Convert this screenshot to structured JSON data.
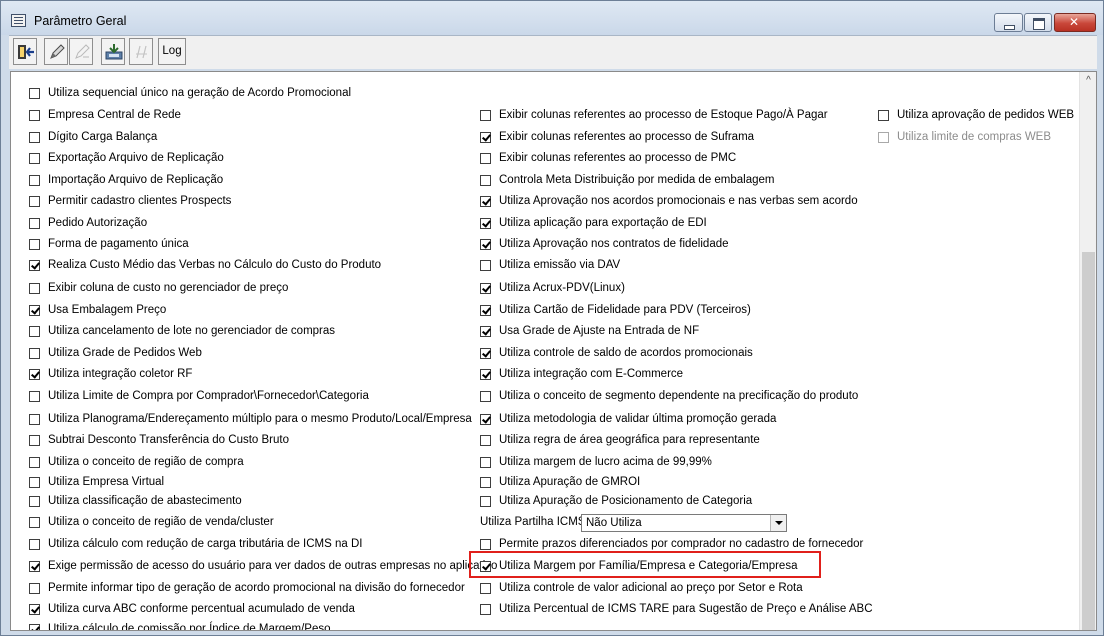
{
  "window": {
    "title": "Parâmetro Geral"
  },
  "toolbar": {
    "buttons": [
      {
        "name": "exit-icon"
      },
      {
        "name": "edit-icon"
      },
      {
        "name": "edit-disabled-icon"
      },
      {
        "name": "save-icon"
      },
      {
        "name": "cancel-disabled-icon"
      }
    ],
    "log_label": "Log"
  },
  "col1": [
    {
      "label": "Utiliza sequencial único na geração de Acordo Promocional",
      "checked": false
    },
    {
      "label": "Empresa Central de Rede",
      "checked": false
    },
    {
      "label": "Dígito Carga Balança",
      "checked": false
    },
    {
      "label": "Exportação Arquivo de Replicação",
      "checked": false
    },
    {
      "label": "Importação Arquivo de Replicação",
      "checked": false
    },
    {
      "label": "Permitir cadastro clientes Prospects",
      "checked": false
    },
    {
      "label": "Pedido Autorização",
      "checked": false
    },
    {
      "label": "Forma de pagamento única",
      "checked": false
    },
    {
      "label": "Realiza Custo Médio das Verbas no Cálculo do Custo do Produto",
      "checked": true
    },
    {
      "label": "Exibir coluna de custo no gerenciador de preço",
      "checked": false
    },
    {
      "label": "Usa Embalagem Preço",
      "checked": true
    },
    {
      "label": "Utiliza cancelamento de lote no gerenciador de compras",
      "checked": false
    },
    {
      "label": "Utiliza Grade de Pedidos Web",
      "checked": false
    },
    {
      "label": "Utiliza integração coletor RF",
      "checked": true
    },
    {
      "label": "Utiliza Limite de Compra por Comprador\\Fornecedor\\Categoria",
      "checked": false
    },
    {
      "label": "Utiliza Planograma/Endereçamento múltiplo para o mesmo Produto/Local/Empresa",
      "checked": false
    },
    {
      "label": "Subtrai Desconto Transferência do Custo Bruto",
      "checked": false
    },
    {
      "label": "Utiliza o conceito de região de compra",
      "checked": false
    },
    {
      "label": "Utiliza Empresa Virtual",
      "checked": false
    },
    {
      "label": "Utiliza classificação de abastecimento",
      "checked": false
    },
    {
      "label": "Utiliza o conceito de região de venda/cluster",
      "checked": false
    },
    {
      "label": "Utiliza cálculo com redução de carga tributária de ICMS na DI",
      "checked": false
    },
    {
      "label": "Exige permissão de acesso do usuário para ver dados de outras empresas no aplicativo",
      "checked": true
    },
    {
      "label": "Permite informar tipo de geração de acordo promocional na divisão do fornecedor",
      "checked": false
    },
    {
      "label": "Utiliza curva ABC conforme percentual acumulado de venda",
      "checked": true
    },
    {
      "label": "Utiliza cálculo de comissão por Índice de Margem/Peso",
      "checked": true
    }
  ],
  "col2": [
    {
      "label": "Exibir colunas referentes ao processo de Estoque Pago/À Pagar",
      "checked": false
    },
    {
      "label": "Exibir colunas referentes ao processo de Suframa",
      "checked": true
    },
    {
      "label": "Exibir colunas referentes ao processo de PMC",
      "checked": false
    },
    {
      "label": "Controla Meta Distribuição por medida de embalagem",
      "checked": false
    },
    {
      "label": "Utiliza Aprovação nos acordos promocionais e nas verbas sem acordo",
      "checked": true
    },
    {
      "label": "Utiliza aplicação para exportação de EDI",
      "checked": true
    },
    {
      "label": "Utiliza Aprovação nos contratos de fidelidade",
      "checked": true
    },
    {
      "label": "Utiliza emissão via DAV",
      "checked": false
    },
    {
      "label": "Utiliza Acrux-PDV(Linux)",
      "checked": true
    },
    {
      "label": "Utiliza Cartão de Fidelidade para PDV (Terceiros)",
      "checked": true
    },
    {
      "label": "Usa Grade de Ajuste na Entrada de NF",
      "checked": true
    },
    {
      "label": "Utiliza controle de saldo de acordos promocionais",
      "checked": true
    },
    {
      "label": "Utiliza integração com E-Commerce",
      "checked": true
    },
    {
      "label": "Utiliza o conceito de segmento dependente na precificação do produto",
      "checked": false
    },
    {
      "label": "Utiliza metodologia de validar última promoção gerada",
      "checked": true
    },
    {
      "label": "Utiliza regra de área geográfica para representante",
      "checked": false
    },
    {
      "label": "Utiliza margem de lucro acima de 99,99%",
      "checked": false
    },
    {
      "label": "Utiliza Apuração de GMROI",
      "checked": false
    },
    {
      "label": "Utiliza Apuração de Posicionamento de Categoria",
      "checked": false
    },
    {
      "label": "Permite prazos diferenciados por comprador no cadastro de fornecedor",
      "checked": false
    },
    {
      "label": "Utiliza Margem por Família/Empresa e Categoria/Empresa",
      "checked": true
    },
    {
      "label": "Utiliza controle de valor adicional ao preço por Setor e Rota",
      "checked": false
    },
    {
      "label": "Utiliza Percentual de ICMS TARE para Sugestão de Preço e Análise ABC",
      "checked": false
    }
  ],
  "col3": [
    {
      "label": "Utiliza aprovação de pedidos WEB",
      "checked": false,
      "disabled": false
    },
    {
      "label": "Utiliza limite de compras WEB",
      "checked": false,
      "disabled": true
    }
  ],
  "partilha": {
    "label": "Utiliza Partilha ICMS",
    "value": "Não Utiliza"
  },
  "colors": {
    "highlight": "#e0201b",
    "titlebar": "#cad8e9"
  }
}
